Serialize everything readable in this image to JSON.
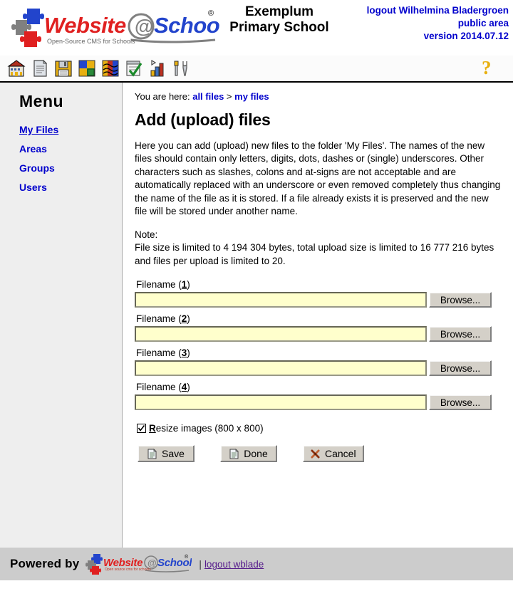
{
  "header": {
    "logo_alt": "Website@School",
    "logo_text_1": "Website",
    "logo_text_at": "@",
    "logo_text_2": "School",
    "logo_tagline": "Open-Source CMS for Schools",
    "logo_registered": "®",
    "school_name_line1": "Exemplum",
    "school_name_line2": "Primary School",
    "logout_user": "logout Wilhelmina Bladergroen",
    "area": "public area",
    "version": "version 2014.07.12"
  },
  "toolbar": {
    "icons": [
      {
        "name": "school-icon",
        "title": "School"
      },
      {
        "name": "page-icon",
        "title": "Pages"
      },
      {
        "name": "save-disk-icon",
        "title": "File manager"
      },
      {
        "name": "modules-puzzle-icon",
        "title": "Modules"
      },
      {
        "name": "users-faces-icon",
        "title": "Users"
      },
      {
        "name": "checklist-icon",
        "title": "Tasks"
      },
      {
        "name": "statistics-chart-icon",
        "title": "Statistics"
      },
      {
        "name": "tools-icon",
        "title": "Tools"
      }
    ],
    "help_label": "?"
  },
  "sidebar": {
    "title": "Menu",
    "items": [
      {
        "label": "My Files",
        "active": true
      },
      {
        "label": "Areas",
        "active": false
      },
      {
        "label": "Groups",
        "active": false
      },
      {
        "label": "Users",
        "active": false
      }
    ]
  },
  "main": {
    "breadcrumb_prefix": "You are here:",
    "breadcrumb_1": "all files",
    "breadcrumb_sep": ">",
    "breadcrumb_2": "my files",
    "page_title": "Add (upload) files",
    "intro": "Here you can add (upload) new files to the folder 'My Files'. The names of the new files should contain only letters, digits, dots, dashes or (single) underscores. Other characters such as slashes, colons and at-signs are not acceptable and are automatically replaced with an underscore or even removed completely thus changing the name of the file as it is stored. If a file already exists it is preserved and the new file will be stored under another name.",
    "note_label": "Note:",
    "note_text": "File size is limited to 4 194 304 bytes, total upload size is limited to 16 777 216 bytes and files per upload is limited to 20.",
    "fields": [
      {
        "label_prefix": "Filename (",
        "key": "1",
        "label_suffix": ")",
        "value": "",
        "browse_label": "Browse..."
      },
      {
        "label_prefix": "Filename (",
        "key": "2",
        "label_suffix": ")",
        "value": "",
        "browse_label": "Browse..."
      },
      {
        "label_prefix": "Filename (",
        "key": "3",
        "label_suffix": ")",
        "value": "",
        "browse_label": "Browse..."
      },
      {
        "label_prefix": "Filename (",
        "key": "4",
        "label_suffix": ")",
        "value": "",
        "browse_label": "Browse..."
      }
    ],
    "resize_checkbox": {
      "checked": true,
      "accesskey": "R",
      "label_rest": "esize images (800 x 800)"
    },
    "buttons": [
      {
        "label": "Save",
        "icon": "page-icon"
      },
      {
        "label": "Done",
        "icon": "page-icon"
      },
      {
        "label": "Cancel",
        "icon": "cancel-x-icon"
      }
    ]
  },
  "footer": {
    "powered_by": "Powered by",
    "logo_text_1": "Website",
    "logo_text_at": "@",
    "logo_text_2": "School",
    "logo_tagline": "Open source cms for schools",
    "separator": "|",
    "logout_link": "logout wblade"
  },
  "colors": {
    "link_blue": "#0000cc",
    "sidebar_bg": "#eeeeee",
    "footer_bg": "#cccccc",
    "input_bg": "#ffffcc",
    "button_face": "#d4d0c8",
    "help_yellow": "#e8b010",
    "visited_link": "#551a8b"
  }
}
